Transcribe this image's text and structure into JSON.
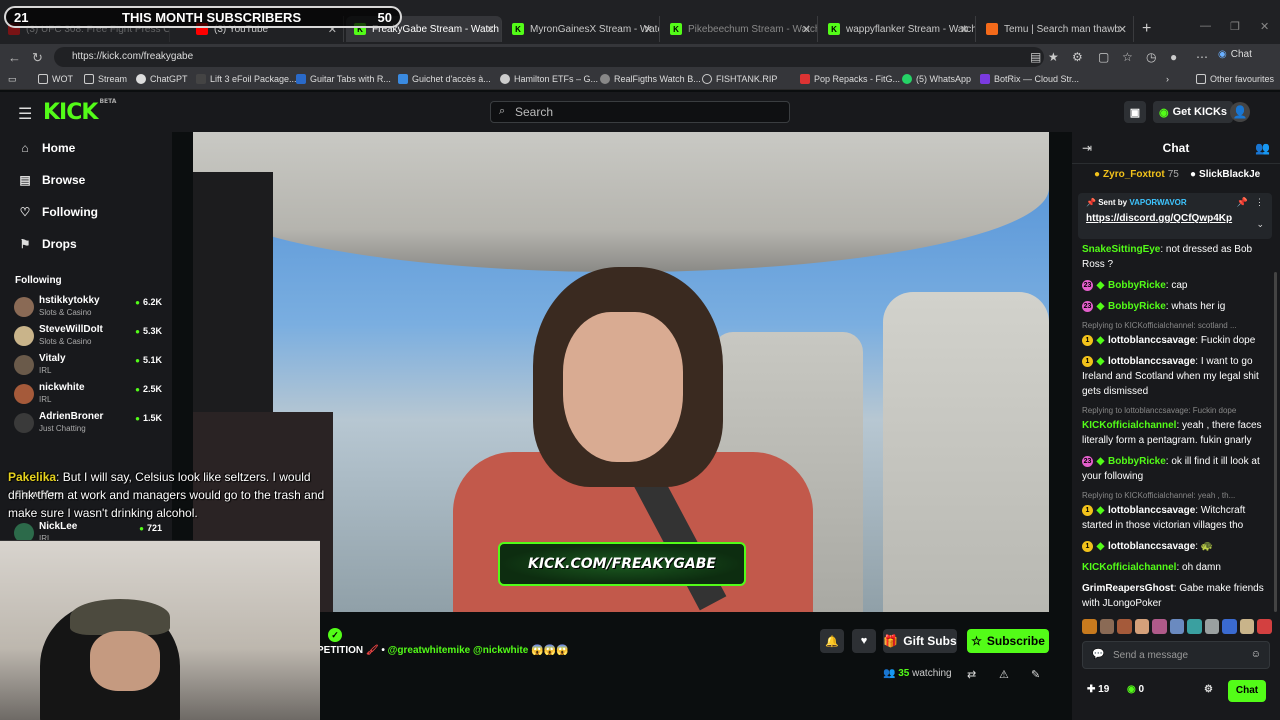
{
  "browser": {
    "tabs": [
      {
        "label": "(3) UFC 308: Free Fight Press Conf",
        "color": "#ff0000"
      },
      {
        "label": "(3) YouTube",
        "color": "#ff0000"
      },
      {
        "label": "FreakyGabe Stream - Watch Li",
        "color": "#53fc18"
      },
      {
        "label": "MyronGainesX Stream - Watc",
        "color": "#53fc18"
      },
      {
        "label": "Pikebeechum Stream - Watch Live",
        "color": "#53fc18"
      },
      {
        "label": "wappyflanker Stream - Watch",
        "color": "#53fc18"
      },
      {
        "label": "Temu | Search man thawb",
        "color": "#f46a1a"
      }
    ],
    "url": "https://kick.com/freakygabe",
    "chat_button": "Chat",
    "bookmarks": [
      "WOT",
      "Stream",
      "ChatGPT",
      "Lift 3 eFoil Package...",
      "Guitar Tabs with R...",
      "Guichet d'accès à...",
      "Hamilton ETFs – G...",
      "RealFigths Watch B...",
      "FISHTANK.RIP",
      "Pop Repacks - FitG...",
      "(5) WhatsApp",
      "BotRix — Cloud Str...",
      "Other favourites"
    ]
  },
  "sub_overlay": {
    "left": "21",
    "title": "THIS MONTH SUBSCRIBERS",
    "right": "50"
  },
  "kick": {
    "logo": "KICK",
    "logo_beta": "BETA",
    "search_placeholder": "Search",
    "get_kicks": "Get KICKs",
    "nav": [
      "Home",
      "Browse",
      "Following",
      "Drops"
    ],
    "following_header": "Following",
    "following": [
      {
        "name": "hstikkytokky",
        "category": "Slots & Casino",
        "viewers": "6.2K",
        "color": "#8a6a55"
      },
      {
        "name": "SteveWillDoIt",
        "category": "Slots & Casino",
        "viewers": "5.3K",
        "color": "#c9b48a"
      },
      {
        "name": "Vitaly",
        "category": "IRL",
        "viewers": "5.1K",
        "color": "#6a5a4a"
      },
      {
        "name": "nickwhite",
        "category": "IRL",
        "viewers": "2.5K",
        "color": "#a55a3a"
      },
      {
        "name": "AdrienBroner",
        "category": "Just Chatting",
        "viewers": "1.5K",
        "color": "#3a3a3a"
      },
      {
        "name": "NickLee",
        "category": "IRL",
        "viewers": "721",
        "color": "#2c6a4a"
      }
    ],
    "show_more": "Show More",
    "overlay_chat": {
      "user": "Pakelika",
      "text": ": But I will say, Celsius look like seltzers. I would drink them at work and managers would go to the trash and make sure I wasn't drinking alcohol."
    },
    "banner": "KICK.COM/FREAKYGABE",
    "stream_title_left": "PETITION",
    "stream_title_tags": "@greatwhitemike @nickwhite 😱😱😱",
    "gift_subs": "Gift Subs",
    "subscribe": "Subscribe",
    "watching_count": "35",
    "watching_label": "watching"
  },
  "chat": {
    "title": "Chat",
    "gifters": [
      {
        "name": "Zyro_Foxtrot",
        "count": "75",
        "color": "#f2c21b"
      },
      {
        "name": "SlickBlackJe",
        "count": "",
        "color": "#ffffff"
      }
    ],
    "pinned_by_label": "Sent by",
    "pinned_by_user": "VAPORWAVOR",
    "pinned_link": "https://discord.gg/QCfQwp4Kp",
    "messages": [
      {
        "reply": "",
        "badge": "",
        "badge_color": "",
        "user": "SnakeSittingEye",
        "user_color": "#53fc18",
        "text": ": not dressed as Bob Ross ?"
      },
      {
        "reply": "",
        "badge": "23",
        "badge_color": "#e35ecb",
        "user": "BobbyRicke",
        "user_color": "#53fc18",
        "text": ": cap"
      },
      {
        "reply": "",
        "badge": "23",
        "badge_color": "#e35ecb",
        "user": "BobbyRicke",
        "user_color": "#53fc18",
        "text": ": whats her ig"
      },
      {
        "reply": "Replying to KICKofficialchannel: scotland ...",
        "badge": "1",
        "badge_color": "#f2c21b",
        "user": "lottoblanccsavage",
        "user_color": "#ffffff",
        "text": ": Fuckin dope"
      },
      {
        "reply": "",
        "badge": "1",
        "badge_color": "#f2c21b",
        "user": "lottoblanccsavage",
        "user_color": "#ffffff",
        "text": ": I want to go Ireland and Scotland when my legal shit gets dismissed"
      },
      {
        "reply": "Replying to lottoblanccsavage: Fuckin dope",
        "badge": "",
        "badge_color": "",
        "user": "KICKofficialchannel",
        "user_color": "#53fc18",
        "text": ": yeah , there faces literally form a pentagram. fukin gnarly"
      },
      {
        "reply": "",
        "badge": "23",
        "badge_color": "#e35ecb",
        "user": "BobbyRicke",
        "user_color": "#53fc18",
        "text": ": ok ill find it ill look at your following"
      },
      {
        "reply": "Replying to KICKofficialchannel: yeah , th...",
        "badge": "1",
        "badge_color": "#f2c21b",
        "user": "lottoblanccsavage",
        "user_color": "#ffffff",
        "text": ": Witchcraft started in those victorian villages tho"
      },
      {
        "reply": "",
        "badge": "1",
        "badge_color": "#f2c21b",
        "user": "lottoblanccsavage",
        "user_color": "#ffffff",
        "text": ": 🐢"
      },
      {
        "reply": "",
        "badge": "",
        "badge_color": "",
        "user": "KICKofficialchannel",
        "user_color": "#53fc18",
        "text": ": oh damn"
      },
      {
        "reply": "",
        "badge": "",
        "badge_color": "",
        "user": "GrimReapersGhost",
        "user_color": "#ffffff",
        "text": ": Gabe make friends with JLongoPoker"
      }
    ],
    "input_placeholder": "Send a message",
    "points": "19",
    "kicks": "0",
    "send": "Chat"
  }
}
